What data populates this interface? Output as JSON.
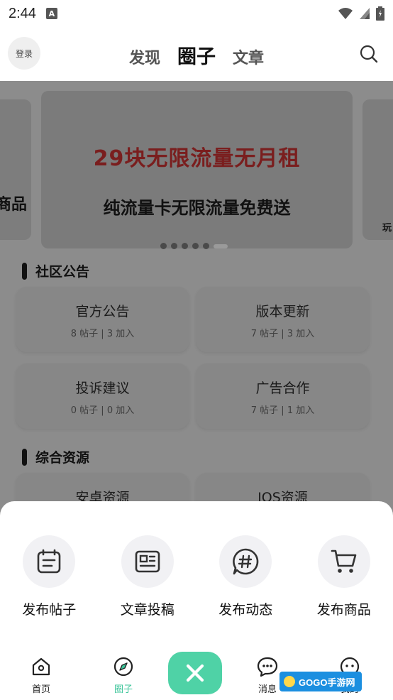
{
  "status_bar": {
    "time": "2:44",
    "app_badge": "A"
  },
  "header": {
    "login_label": "登录",
    "tabs": [
      {
        "label": "发现",
        "active": false
      },
      {
        "label": "圈子",
        "active": true
      },
      {
        "label": "文章",
        "active": false
      }
    ]
  },
  "banner": {
    "left_peek": "商品",
    "right_peek": "玩",
    "title": "29块无限流量无月租",
    "subtitle": "纯流量卡无限流量免费送",
    "page_count": 6,
    "active_index": 5
  },
  "sections": [
    {
      "title": "社区公告",
      "cards": [
        {
          "name": "官方公告",
          "meta": "8 帖子 | 3 加入"
        },
        {
          "name": "版本更新",
          "meta": "7 帖子 | 3 加入"
        },
        {
          "name": "投诉建议",
          "meta": "0 帖子 | 0 加入"
        },
        {
          "name": "广告合作",
          "meta": "7 帖子 | 1 加入"
        }
      ]
    },
    {
      "title": "综合资源",
      "cards": [
        {
          "name": "安卓资源",
          "meta": ""
        },
        {
          "name": "IOS资源",
          "meta": ""
        }
      ]
    }
  ],
  "sheet_actions": [
    {
      "label": "发布帖子",
      "icon": "calendar-icon"
    },
    {
      "label": "文章投稿",
      "icon": "article-icon"
    },
    {
      "label": "发布动态",
      "icon": "hashtag-icon"
    },
    {
      "label": "发布商品",
      "icon": "cart-icon"
    }
  ],
  "bottom_nav": [
    {
      "label": "首页",
      "active": false
    },
    {
      "label": "圈子",
      "active": true
    },
    {
      "label": "消息",
      "active": false
    },
    {
      "label": "我的",
      "active": false
    }
  ],
  "watermark": "GOGO手游网",
  "colors": {
    "accent": "#4fd2a6",
    "accent_text": "#3cc59a",
    "banner_title": "#7a1e1e"
  }
}
